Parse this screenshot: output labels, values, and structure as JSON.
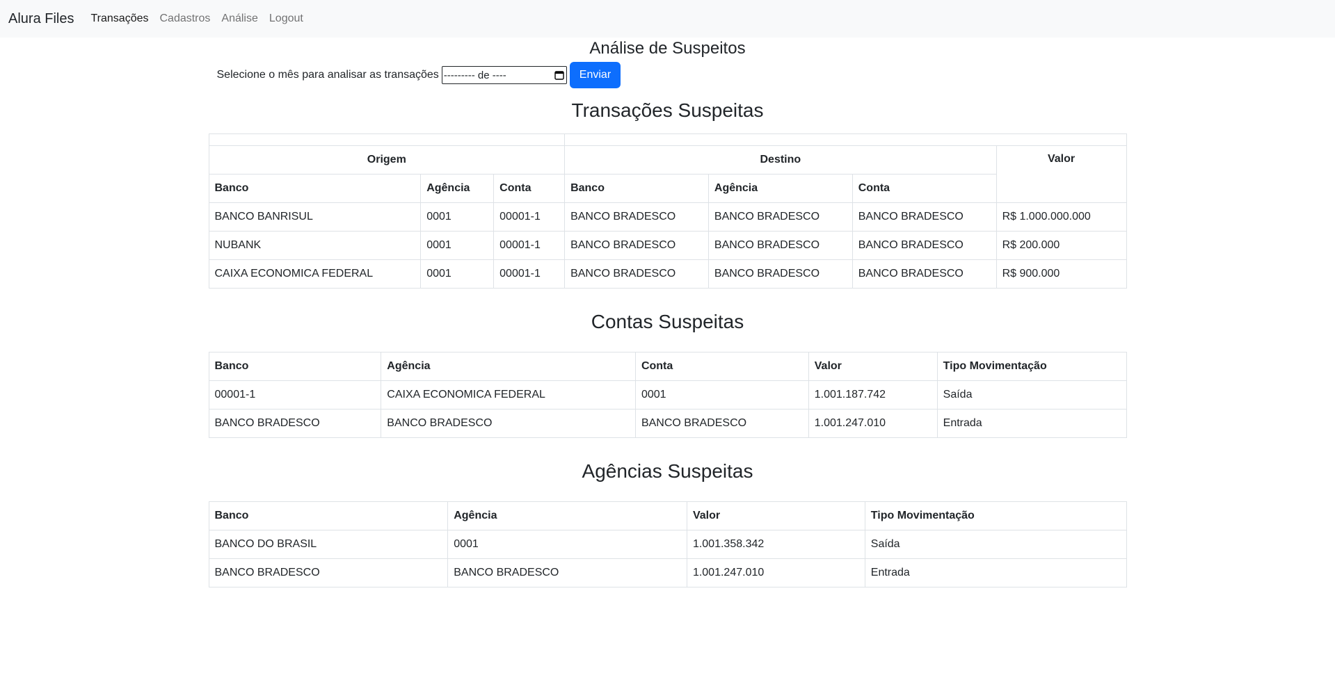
{
  "nav": {
    "brand": "Alura Files",
    "links": [
      "Transações",
      "Cadastros",
      "Análise",
      "Logout"
    ]
  },
  "page": {
    "title": "Análise de Suspeitos",
    "form_label": "Selecione o mês para analisar as transações",
    "month_placeholder": "--------- de ----",
    "submit_label": "Enviar"
  },
  "transacoes": {
    "title": "Transações Suspeitas",
    "group_origem": "Origem",
    "group_destino": "Destino",
    "col_valor": "Valor",
    "cols": [
      "Banco",
      "Agência",
      "Conta",
      "Banco",
      "Agência",
      "Conta"
    ],
    "rows": [
      [
        "BANCO BANRISUL",
        "0001",
        "00001-1",
        "BANCO BRADESCO",
        "BANCO BRADESCO",
        "BANCO BRADESCO",
        "R$ 1.000.000.000"
      ],
      [
        "NUBANK",
        "0001",
        "00001-1",
        "BANCO BRADESCO",
        "BANCO BRADESCO",
        "BANCO BRADESCO",
        "R$ 200.000"
      ],
      [
        "CAIXA ECONOMICA FEDERAL",
        "0001",
        "00001-1",
        "BANCO BRADESCO",
        "BANCO BRADESCO",
        "BANCO BRADESCO",
        "R$ 900.000"
      ]
    ]
  },
  "contas": {
    "title": "Contas Suspeitas",
    "cols": [
      "Banco",
      "Agência",
      "Conta",
      "Valor",
      "Tipo Movimentação"
    ],
    "rows": [
      [
        "00001-1",
        "CAIXA ECONOMICA FEDERAL",
        "0001",
        "1.001.187.742",
        "Saída"
      ],
      [
        "BANCO BRADESCO",
        "BANCO BRADESCO",
        "BANCO BRADESCO",
        "1.001.247.010",
        "Entrada"
      ]
    ]
  },
  "agencias": {
    "title": "Agências Suspeitas",
    "cols": [
      "Banco",
      "Agência",
      "Valor",
      "Tipo Movimentação"
    ],
    "rows": [
      [
        "BANCO DO BRASIL",
        "0001",
        "1.001.358.342",
        "Saída"
      ],
      [
        "BANCO BRADESCO",
        "BANCO BRADESCO",
        "1.001.247.010",
        "Entrada"
      ]
    ]
  }
}
